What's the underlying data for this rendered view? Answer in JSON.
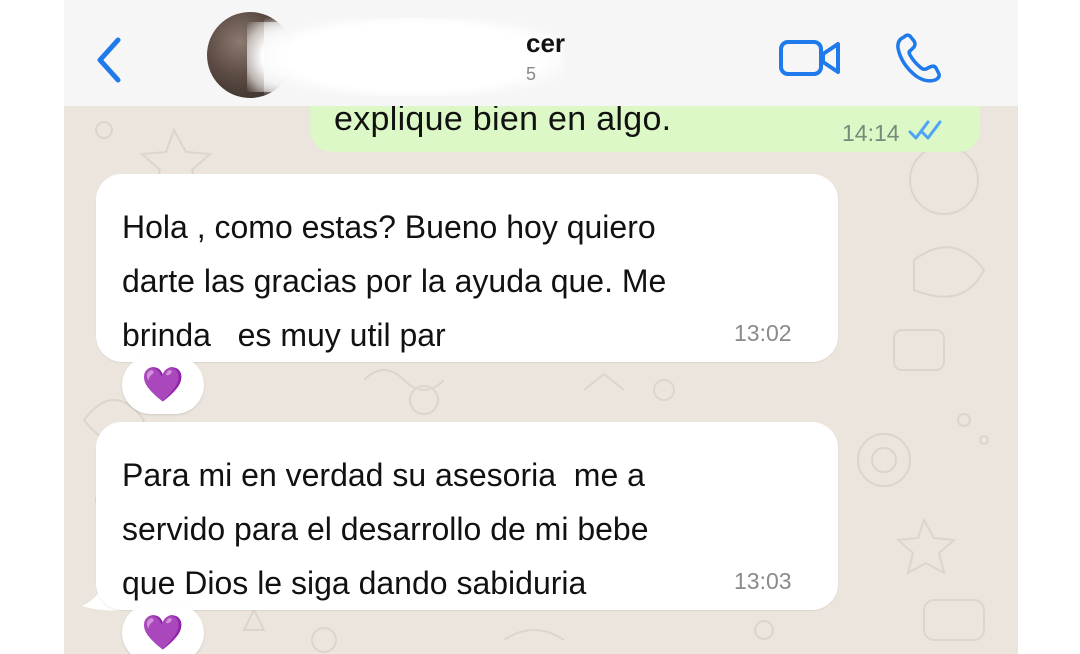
{
  "header": {
    "contact_name_visible": "cer",
    "contact_status_visible": "5",
    "back_icon": "chevron-left-icon",
    "video_icon": "video-camera-icon",
    "call_icon": "phone-icon"
  },
  "messages": [
    {
      "direction": "outgoing",
      "text": "explique bien en algo.",
      "time": "14:14",
      "status": "read"
    },
    {
      "direction": "incoming",
      "text": "Hola , como estas? Bueno hoy quiero\ndarte las gracias por la ayuda que. Me\nbrinda   es muy util par",
      "time": "13:02",
      "reaction": "💜"
    },
    {
      "direction": "incoming",
      "text": "Para mi en verdad su asesoria  me a\nservido para el desarrollo de mi bebe\nque Dios le siga dando sabiduria",
      "time": "13:03",
      "reaction": "💜"
    }
  ],
  "colors": {
    "accent": "#1f7aeb",
    "outgoing_bubble": "#dcf8c6",
    "incoming_bubble": "#ffffff",
    "chat_background": "#ece5dd",
    "read_ticks": "#4fa3f7"
  }
}
